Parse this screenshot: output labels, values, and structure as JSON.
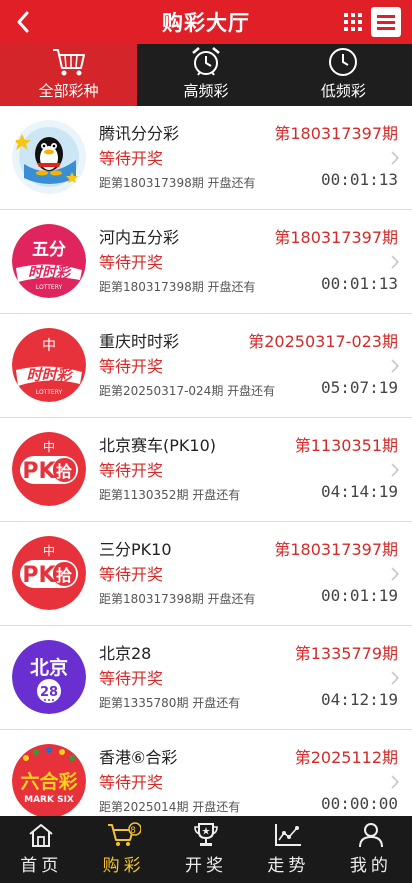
{
  "header": {
    "title": "购彩大厅"
  },
  "tabs": [
    {
      "label": "全部彩种",
      "icon": "basket-icon",
      "active": true
    },
    {
      "label": "高频彩",
      "icon": "alarm-clock-icon",
      "active": false
    },
    {
      "label": "低频彩",
      "icon": "clock-icon",
      "active": false
    }
  ],
  "items": [
    {
      "name": "腾讯分分彩",
      "period": "第180317397期",
      "status": "等待开奖",
      "next": "距第180317398期 开盘还有",
      "countdown": "00:01:13",
      "logo": "tencent-penguin-logo"
    },
    {
      "name": "河内五分彩",
      "period": "第180317397期",
      "status": "等待开奖",
      "next": "距第180317398期 开盘还有",
      "countdown": "00:01:13",
      "logo": "hanoi-5min-logo",
      "logo_text": [
        "五分",
        "时时彩",
        "LOTTERY"
      ]
    },
    {
      "name": "重庆时时彩",
      "period": "第20250317-023期",
      "status": "等待开奖",
      "next": "距第20250317-024期 开盘还有",
      "countdown": "05:07:19",
      "logo": "chongqing-ssc-logo",
      "logo_text": [
        "时时彩",
        "LOTTERY"
      ]
    },
    {
      "name": "北京赛车(PK10)",
      "period": "第1130351期",
      "status": "等待开奖",
      "next": "距第1130352期 开盘还有",
      "countdown": "04:14:19",
      "logo": "pk10-logo",
      "logo_text": [
        "PK",
        "拾"
      ]
    },
    {
      "name": "三分PK10",
      "period": "第180317397期",
      "status": "等待开奖",
      "next": "距第180317398期 开盘还有",
      "countdown": "00:01:19",
      "logo": "pk10-3min-logo",
      "logo_text": [
        "PK",
        "拾"
      ]
    },
    {
      "name": "北京28",
      "period": "第1335779期",
      "status": "等待开奖",
      "next": "距第1335780期 开盘还有",
      "countdown": "04:12:19",
      "logo": "beijing28-logo",
      "logo_text": [
        "北京",
        "28"
      ]
    },
    {
      "name": "香港⑥合彩",
      "period": "第2025112期",
      "status": "等待开奖",
      "next": "距第2025014期 开盘还有",
      "countdown": "00:00:00",
      "logo": "mark-six-logo",
      "logo_text": [
        "六合彩",
        "MARK SIX"
      ]
    }
  ],
  "bottom_nav": [
    {
      "label": "首页",
      "icon": "home-icon",
      "active": false
    },
    {
      "label": "购彩",
      "icon": "cart-icon",
      "active": true,
      "badge": "8"
    },
    {
      "label": "开奖",
      "icon": "trophy-icon",
      "active": false
    },
    {
      "label": "走势",
      "icon": "trend-chart-icon",
      "active": false
    },
    {
      "label": "我的",
      "icon": "user-icon",
      "active": false
    }
  ],
  "colors": {
    "brand_red": "#e01f26",
    "active_tab": "#d3252a",
    "dark_bar": "#1e1e1e",
    "nav_active": "#f2c230",
    "accent_red_text": "#d42a2a"
  }
}
